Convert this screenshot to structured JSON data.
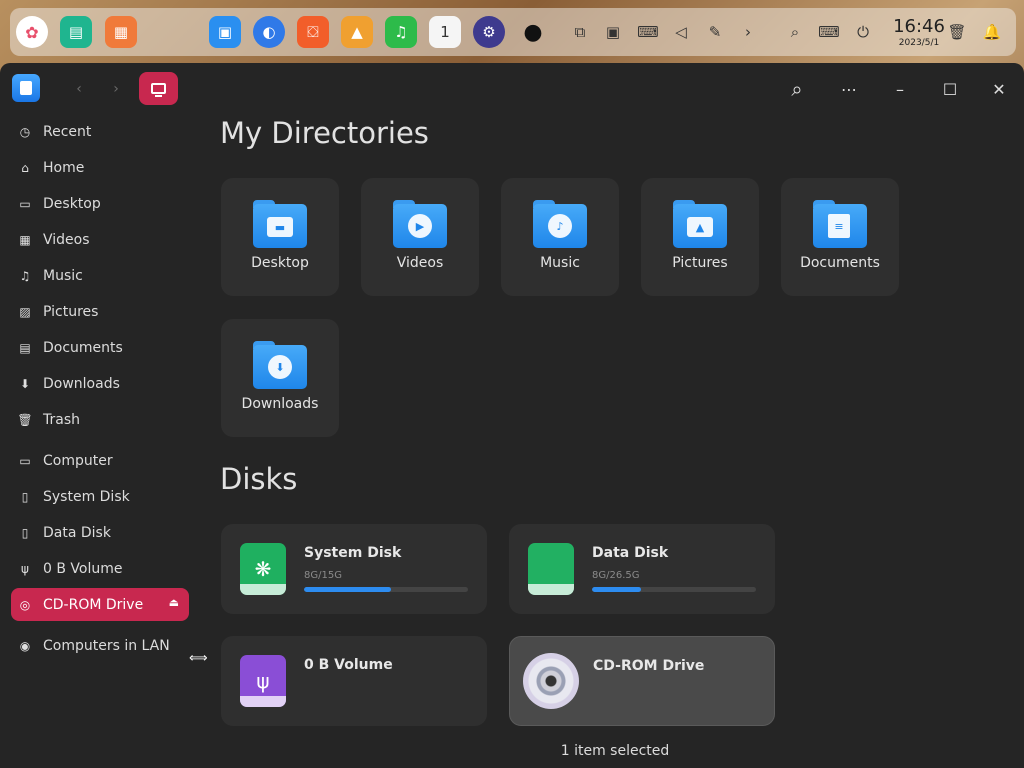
{
  "dock": {
    "apps": [
      {
        "name": "launcher-icon",
        "color": "#e84f6b"
      },
      {
        "name": "multitask-icon",
        "color": "#1fb58f"
      },
      {
        "name": "workspace-icon",
        "color": "#f07a3a"
      },
      {
        "name": "file-manager-icon",
        "color": "#2a8ff0"
      },
      {
        "name": "browser-icon",
        "color": "#2f79e8"
      },
      {
        "name": "app-store-icon",
        "color": "#f25e2a"
      },
      {
        "name": "photos-icon",
        "color": "#f0a030"
      },
      {
        "name": "music-icon",
        "color": "#2dbb4a"
      },
      {
        "name": "calendar-icon",
        "color": "#f5f5f5"
      },
      {
        "name": "settings-icon",
        "color": "#3e3a8e"
      },
      {
        "name": "penguin-icon",
        "color": "#222222"
      }
    ],
    "tray": [
      "screen-switch-icon",
      "screenshot-icon",
      "keyboard-icon",
      "volume-icon",
      "pen-icon",
      "chevron-right-icon",
      "search-icon",
      "keyboard-layout-icon",
      "power-icon"
    ],
    "clock": {
      "time": "16:46",
      "date": "2023/5/1"
    }
  },
  "window": {
    "sidebar": {
      "items": [
        {
          "label": "Recent",
          "icon": "clock-icon"
        },
        {
          "label": "Home",
          "icon": "home-icon"
        },
        {
          "label": "Desktop",
          "icon": "desktop-icon"
        },
        {
          "label": "Videos",
          "icon": "video-icon"
        },
        {
          "label": "Music",
          "icon": "music-note-icon"
        },
        {
          "label": "Pictures",
          "icon": "image-icon"
        },
        {
          "label": "Documents",
          "icon": "document-icon"
        },
        {
          "label": "Downloads",
          "icon": "download-icon"
        },
        {
          "label": "Trash",
          "icon": "trash-icon"
        },
        {
          "label": "Computer",
          "icon": "computer-icon"
        },
        {
          "label": "System Disk",
          "icon": "disk-icon"
        },
        {
          "label": "Data Disk",
          "icon": "disk-icon"
        },
        {
          "label": "0 B Volume",
          "icon": "usb-icon"
        },
        {
          "label": "CD-ROM Drive",
          "icon": "cdrom-icon",
          "active": true
        },
        {
          "label": "Computers in LAN",
          "icon": "network-icon"
        }
      ]
    },
    "main": {
      "directories_title": "My Directories",
      "directories": [
        {
          "label": "Desktop",
          "emblem": "desktop-emblem-icon"
        },
        {
          "label": "Videos",
          "emblem": "play-emblem-icon"
        },
        {
          "label": "Music",
          "emblem": "music-emblem-icon"
        },
        {
          "label": "Pictures",
          "emblem": "picture-emblem-icon"
        },
        {
          "label": "Documents",
          "emblem": "document-emblem-icon"
        },
        {
          "label": "Downloads",
          "emblem": "download-emblem-icon"
        }
      ],
      "disks_title": "Disks",
      "disks": [
        {
          "name": "System Disk",
          "size": "8G/15G",
          "usage": 0.53,
          "color": "#1fb060"
        },
        {
          "name": "Data Disk",
          "size": "8G/26.5G",
          "usage": 0.3,
          "color": "#22b062"
        },
        {
          "name": "0 B Volume",
          "size": "",
          "usage": null,
          "color": "#8a4ed6"
        },
        {
          "name": "CD-ROM Drive",
          "size": "",
          "usage": null,
          "color": "#cfcfd8",
          "selected": true
        }
      ]
    },
    "status": "1 item selected"
  }
}
